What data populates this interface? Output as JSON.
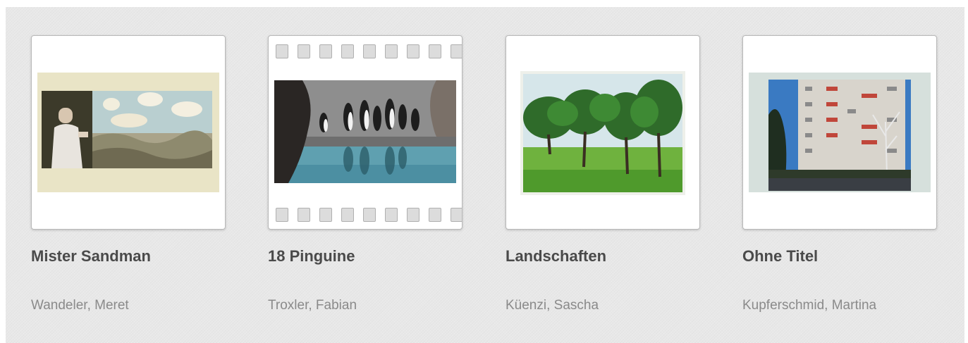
{
  "gallery": {
    "items": [
      {
        "title": "Mister Sandman",
        "author": "Wandeler, Meret",
        "frame_style": "print"
      },
      {
        "title": "18 Pinguine",
        "author": "Troxler, Fabian",
        "frame_style": "filmstrip"
      },
      {
        "title": "Landschaften",
        "author": "Küenzi, Sascha",
        "frame_style": "print"
      },
      {
        "title": "Ohne Titel",
        "author": "Kupferschmid, Martina",
        "frame_style": "print"
      }
    ]
  },
  "colors": {
    "panel_background": "#e8e8e8",
    "card_background": "#ffffff",
    "title_text": "#4a4a4a",
    "author_text": "#8a8a8a"
  }
}
